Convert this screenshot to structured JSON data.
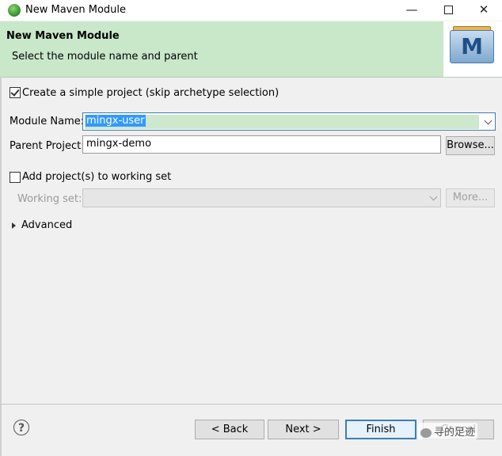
{
  "window": {
    "title": "New Maven Module",
    "minimize_glyph": "—",
    "close_glyph": "✕"
  },
  "banner": {
    "title": "New Maven Module",
    "description": "Select the module name and parent",
    "logo_letter": "M"
  },
  "form": {
    "simple_project": {
      "label": "Create a simple project (skip archetype selection)",
      "checked": true
    },
    "module_name": {
      "label": "Module Name:",
      "value": "mingx-user"
    },
    "parent_project": {
      "label": "Parent Project:",
      "value": "mingx-demo",
      "browse_label": "Browse..."
    },
    "working_set_add": {
      "label": "Add project(s) to working set",
      "checked": false
    },
    "working_set": {
      "label": "Working set:",
      "value": "",
      "more_label": "More..."
    },
    "advanced": {
      "label": "Advanced"
    }
  },
  "footer": {
    "help_glyph": "?",
    "back_label": "< Back",
    "next_label": "Next >",
    "finish_label": "Finish",
    "cancel_label": "Cancel",
    "watermark_text": "寻的足迹"
  },
  "icons": {
    "app": "eclipse-maven-icon",
    "logo": "maven-m-logo-icon",
    "help": "help-icon",
    "expander": "triangle-right-icon"
  }
}
